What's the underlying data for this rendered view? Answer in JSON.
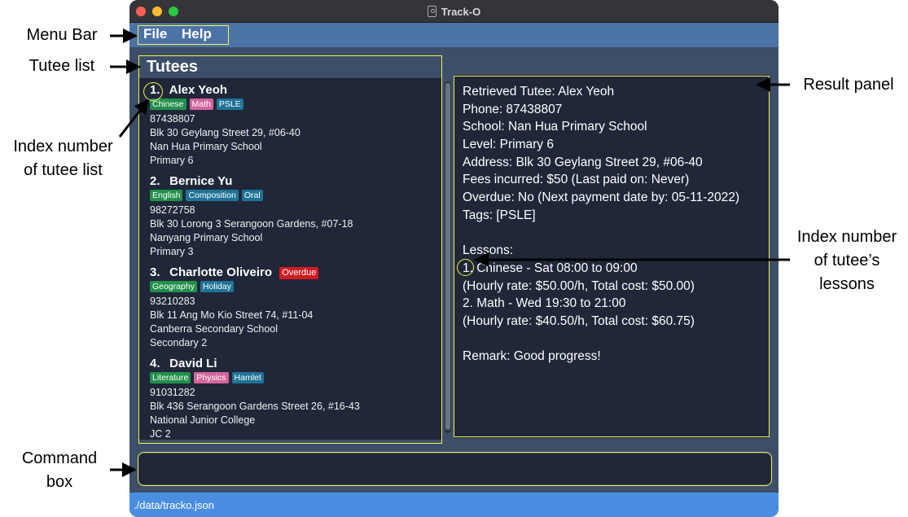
{
  "window": {
    "title": "Track-O"
  },
  "menu": {
    "file": "File",
    "help": "Help"
  },
  "tutee_list": {
    "title": "Tutees",
    "tutees": [
      {
        "index": "1.",
        "name": "Alex Yeoh",
        "overdue": "",
        "tags": [
          {
            "label": "Chinese",
            "color": "#22904a"
          },
          {
            "label": "Math",
            "color": "#d4659c"
          },
          {
            "label": "PSLE",
            "color": "#1f7396"
          }
        ],
        "phone": "87438807",
        "address": "Blk 30 Geylang Street 29, #06-40",
        "school": "Nan Hua Primary School",
        "level": "Primary 6"
      },
      {
        "index": "2.",
        "name": "Bernice Yu",
        "overdue": "",
        "tags": [
          {
            "label": "English",
            "color": "#22904a"
          },
          {
            "label": "Composition",
            "color": "#1f7396"
          },
          {
            "label": "Oral",
            "color": "#1f7396"
          }
        ],
        "phone": "98272758",
        "address": "Blk 30 Lorong 3 Serangoon Gardens, #07-18",
        "school": "Nanyang Primary School",
        "level": "Primary 3"
      },
      {
        "index": "3.",
        "name": "Charlotte Oliveiro",
        "overdue": "Overdue",
        "tags": [
          {
            "label": "Geography",
            "color": "#22904a"
          },
          {
            "label": "Holiday",
            "color": "#1f7396"
          }
        ],
        "phone": "93210283",
        "address": "Blk 11 Ang Mo Kio Street 74, #11-04",
        "school": "Canberra Secondary School",
        "level": "Secondary 2"
      },
      {
        "index": "4.",
        "name": "David Li",
        "overdue": "",
        "tags": [
          {
            "label": "Literature",
            "color": "#22904a"
          },
          {
            "label": "Physics",
            "color": "#d4659c"
          },
          {
            "label": "Hamlet",
            "color": "#1f7396"
          }
        ],
        "phone": "91031282",
        "address": "Blk 436 Serangoon Gardens Street 26, #16-43",
        "school": "National Junior College",
        "level": "JC 2"
      }
    ]
  },
  "result": {
    "lines": [
      "Retrieved Tutee: Alex Yeoh",
      "Phone: 87438807",
      "School: Nan Hua Primary School",
      "Level: Primary 6",
      "Address: Blk 30 Geylang Street 29, #06-40",
      "Fees incurred: $50 (Last paid on: Never)",
      "Overdue: No (Next payment date by: 05-11-2022)",
      "Tags: [PSLE]",
      "",
      "Lessons:",
      "1. Chinese  -  Sat 08:00 to 09:00",
      "(Hourly rate: $50.00/h, Total cost: $50.00)",
      "2. Math  -  Wed 19:30 to 21:00",
      "(Hourly rate: $40.50/h, Total cost: $60.75)",
      "",
      "Remark: Good progress!"
    ]
  },
  "command_box": {
    "value": ""
  },
  "status_bar": {
    "path": "./data/tracko.json"
  },
  "annotations": {
    "menu_bar": "Menu Bar",
    "tutee_list": "Tutee list",
    "index_tutee_1": "Index number",
    "index_tutee_2": "of tutee list",
    "result_panel": "Result panel",
    "index_lessons_1": "Index number",
    "index_lessons_2": "of tutee’s",
    "index_lessons_3": "lessons",
    "command_box_1": "Command",
    "command_box_2": "box"
  },
  "colors": {
    "highlight": "#f2f248",
    "menu_bar": "#4c73a6",
    "status_bar": "#4a8ee2",
    "panel": "#1f2739",
    "background": "#3d4e68"
  }
}
